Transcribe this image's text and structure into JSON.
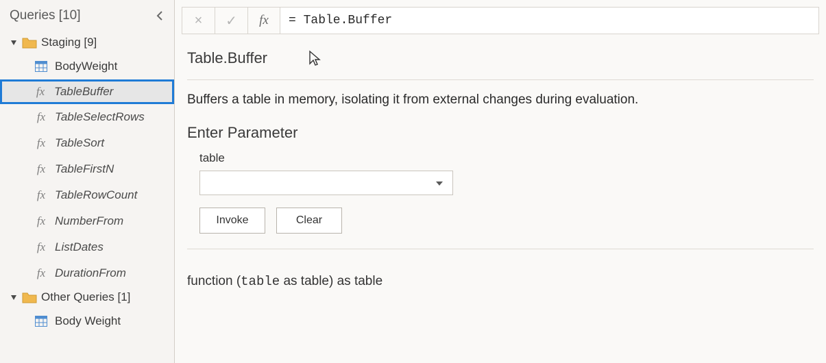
{
  "sidebar": {
    "title": "Queries [10]",
    "groups": [
      {
        "label": "Staging [9]",
        "items": [
          {
            "type": "table",
            "label": "BodyWeight",
            "selected": false
          },
          {
            "type": "fx",
            "label": "TableBuffer",
            "selected": true
          },
          {
            "type": "fx",
            "label": "TableSelectRows",
            "selected": false
          },
          {
            "type": "fx",
            "label": "TableSort",
            "selected": false
          },
          {
            "type": "fx",
            "label": "TableFirstN",
            "selected": false
          },
          {
            "type": "fx",
            "label": "TableRowCount",
            "selected": false
          },
          {
            "type": "fx",
            "label": "NumberFrom",
            "selected": false
          },
          {
            "type": "fx",
            "label": "ListDates",
            "selected": false
          },
          {
            "type": "fx",
            "label": "DurationFrom",
            "selected": false
          }
        ]
      },
      {
        "label": "Other Queries [1]",
        "items": [
          {
            "type": "table",
            "label": "Body Weight",
            "selected": false
          }
        ]
      }
    ]
  },
  "formulaBar": {
    "cancel_icon": "×",
    "commit_icon": "✓",
    "fx_icon": "fx",
    "value": "= Table.Buffer"
  },
  "main": {
    "fn_title": "Table.Buffer",
    "description": "Buffers a table in memory, isolating it from external changes during evaluation.",
    "param_heading": "Enter Parameter",
    "param_label": "table",
    "invoke_label": "Invoke",
    "clear_label": "Clear",
    "signature_prefix": "function (",
    "signature_param": "table",
    "signature_mid": " as table) as table"
  }
}
